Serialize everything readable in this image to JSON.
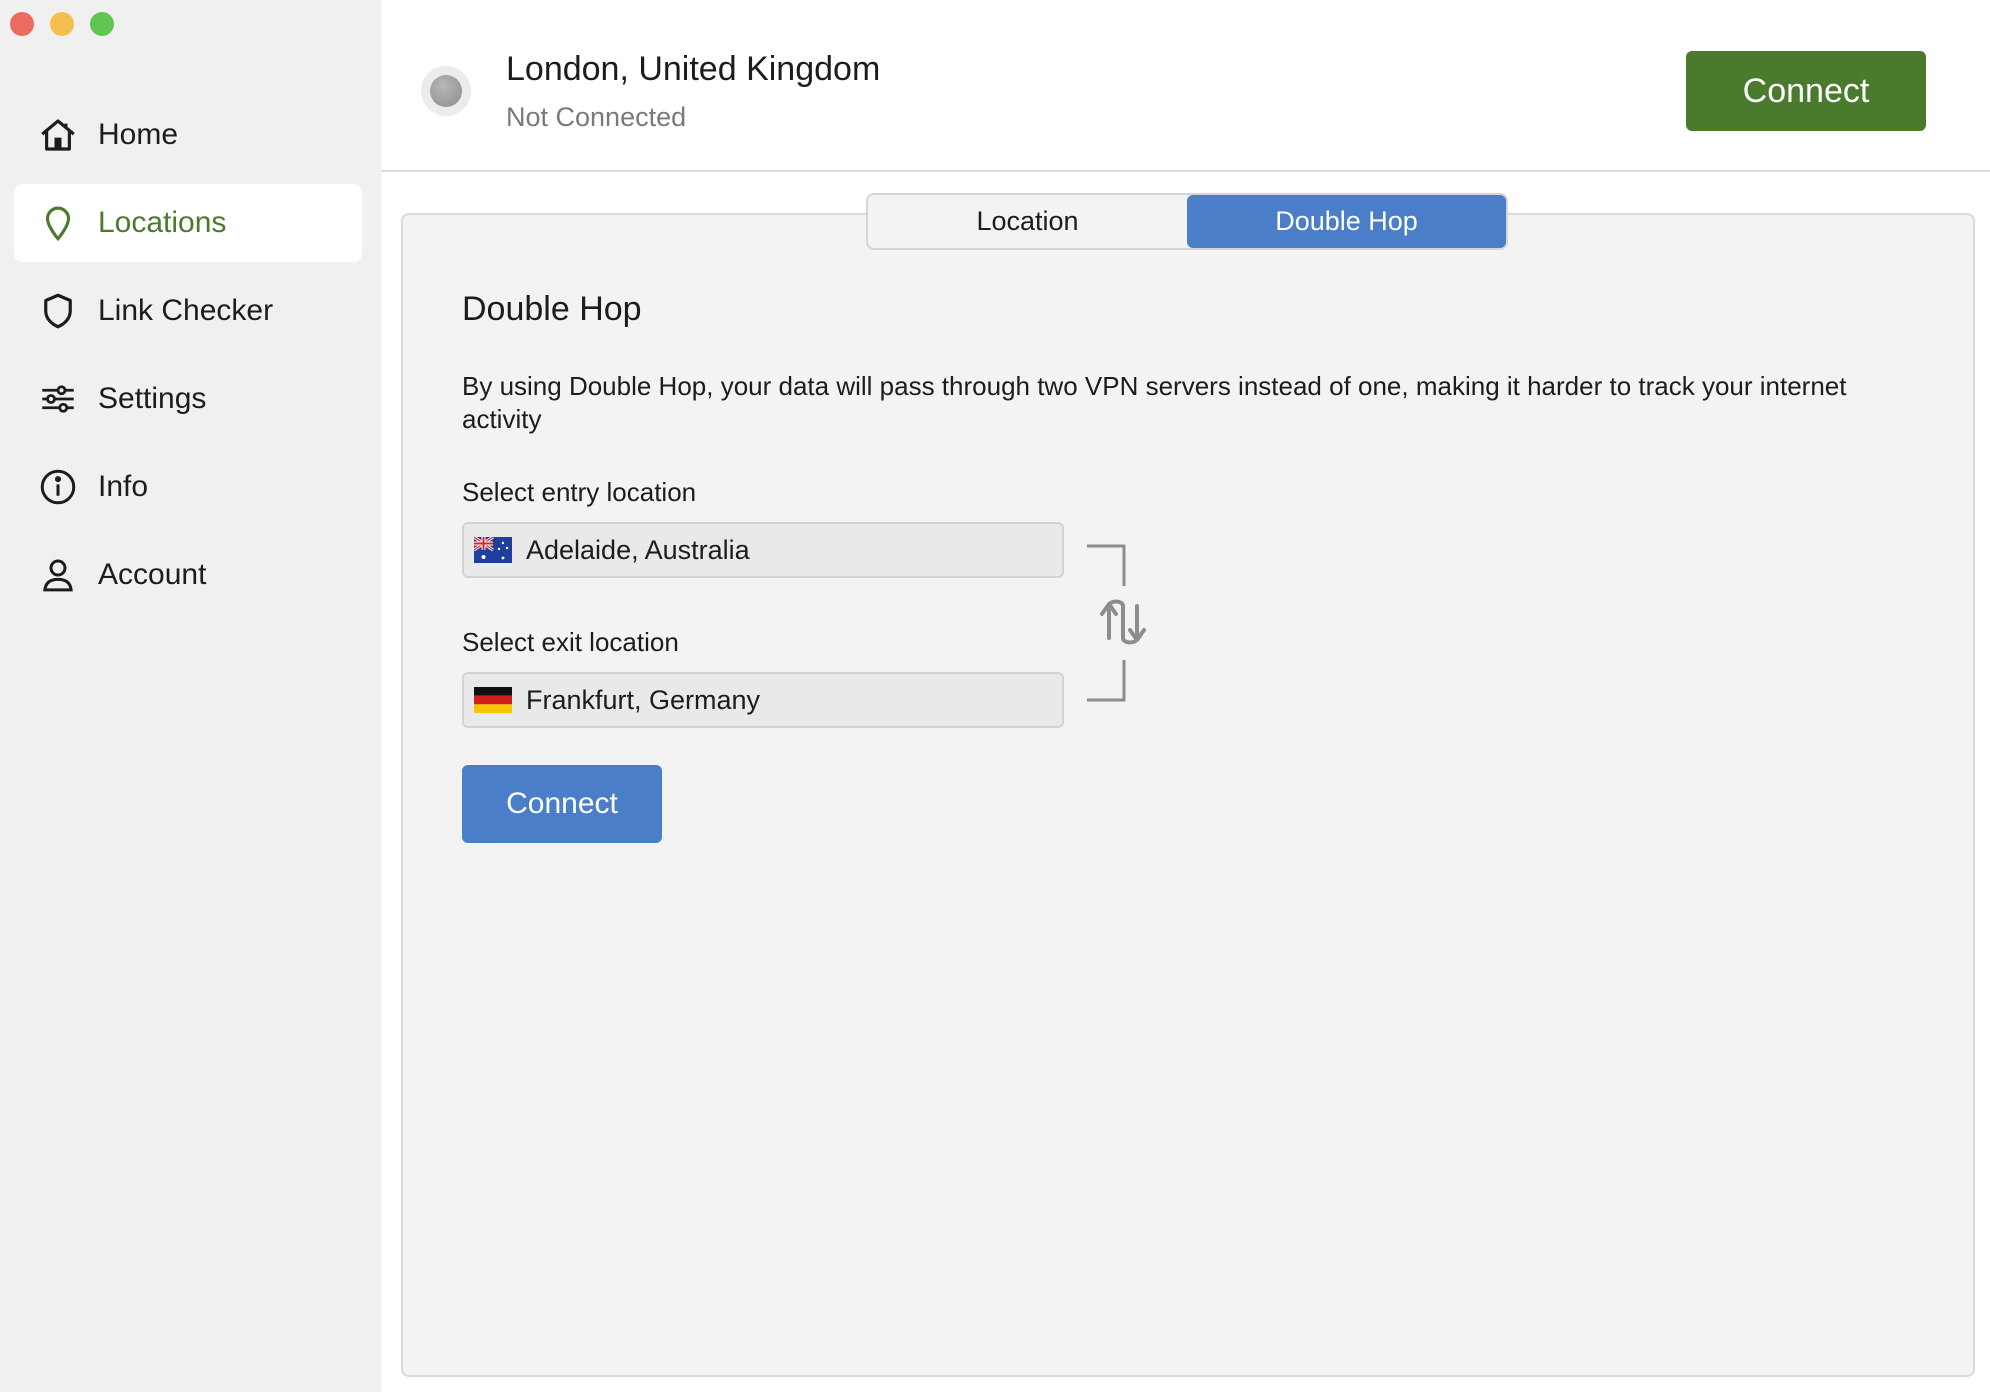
{
  "sidebar": {
    "items": [
      {
        "label": "Home"
      },
      {
        "label": "Locations"
      },
      {
        "label": "Link Checker"
      },
      {
        "label": "Settings"
      },
      {
        "label": "Info"
      },
      {
        "label": "Account"
      }
    ],
    "active_index": 1
  },
  "header": {
    "location": "London, United Kingdom",
    "status": "Not Connected",
    "connect_label": "Connect"
  },
  "tabs": [
    {
      "label": "Location"
    },
    {
      "label": "Double Hop"
    }
  ],
  "double_hop": {
    "title": "Double Hop",
    "description": "By using Double Hop, your data will pass through two VPN servers instead of one, making it harder to track your internet activity",
    "entry_label": "Select entry location",
    "entry_value": "Adelaide, Australia",
    "exit_label": "Select exit location",
    "exit_value": "Frankfurt, Germany",
    "connect_label": "Connect"
  },
  "colors": {
    "accent_green": "#4a7a2c",
    "accent_blue": "#4a7ec8",
    "sidebar_bg": "#f0f0f0"
  },
  "icons": {
    "home": "home-icon",
    "locations": "location-pin-icon",
    "link_checker": "shield-icon",
    "settings": "sliders-icon",
    "info": "info-icon",
    "account": "person-icon",
    "swap": "swap-arrows-icon"
  }
}
